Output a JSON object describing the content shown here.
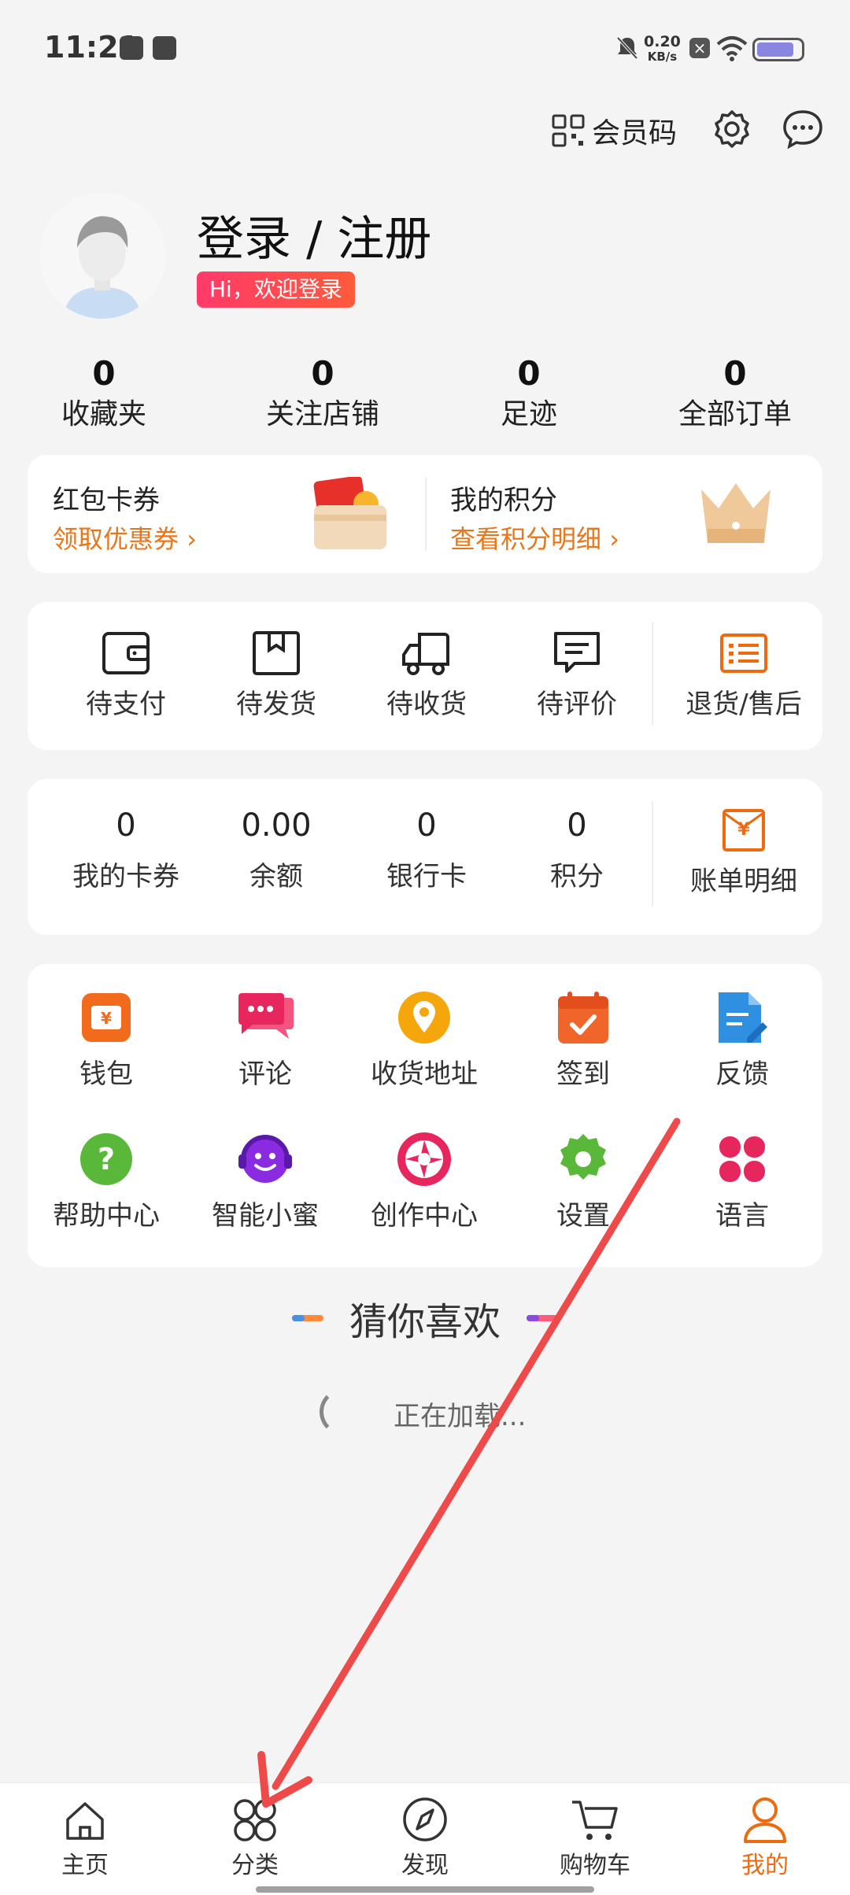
{
  "status_bar": {
    "time": "11:21",
    "net_speed_value": "0.20",
    "net_speed_unit": "KB/s",
    "battery_level": 0.85
  },
  "top_actions": {
    "member_code_label": "会员码"
  },
  "profile": {
    "login_label": "登录 / 注册",
    "welcome_text": "Hi，欢迎登录"
  },
  "stats": [
    {
      "value": "0",
      "label": "收藏夹"
    },
    {
      "value": "0",
      "label": "关注店铺"
    },
    {
      "value": "0",
      "label": "足迹"
    },
    {
      "value": "0",
      "label": "全部订单"
    }
  ],
  "coupon_card": {
    "left": {
      "title": "红包卡券",
      "link": "领取优惠券"
    },
    "right": {
      "title": "我的积分",
      "link": "查看积分明细"
    }
  },
  "orders": [
    {
      "label": "待支付",
      "icon": "wallet-icon"
    },
    {
      "label": "待发货",
      "icon": "box-icon"
    },
    {
      "label": "待收货",
      "icon": "truck-icon"
    },
    {
      "label": "待评价",
      "icon": "comment-icon"
    },
    {
      "label": "退货/售后",
      "icon": "return-list-icon"
    }
  ],
  "assets": [
    {
      "value": "0",
      "label": "我的卡券"
    },
    {
      "value": "0.00",
      "label": "余额"
    },
    {
      "value": "0",
      "label": "银行卡"
    },
    {
      "value": "0",
      "label": "积分"
    }
  ],
  "bill_label": "账单明细",
  "tools": [
    {
      "label": "钱包",
      "icon": "wallet-icon",
      "color": "#f26b1d"
    },
    {
      "label": "评论",
      "icon": "chat-icon",
      "color": "#e8265e"
    },
    {
      "label": "收货地址",
      "icon": "location-icon",
      "color": "#f5a60a"
    },
    {
      "label": "签到",
      "icon": "calendar-check-icon",
      "color": "#f0652a"
    },
    {
      "label": "反馈",
      "icon": "feedback-doc-icon",
      "color": "#2f8fe0"
    },
    {
      "label": "帮助中心",
      "icon": "help-icon",
      "color": "#59b83a"
    },
    {
      "label": "智能小蜜",
      "icon": "assistant-icon",
      "color": "#8a2be2"
    },
    {
      "label": "创作中心",
      "icon": "aperture-icon",
      "color": "#e8265e"
    },
    {
      "label": "设置",
      "icon": "gear-icon",
      "color": "#59b83a"
    },
    {
      "label": "语言",
      "icon": "clover-icon",
      "color": "#e8265e"
    }
  ],
  "guess": {
    "title": "猜你喜欢",
    "loading_text": "正在加载..."
  },
  "nav": [
    {
      "label": "主页",
      "icon": "home-icon",
      "active": false
    },
    {
      "label": "分类",
      "icon": "category-icon",
      "active": false
    },
    {
      "label": "发现",
      "icon": "compass-icon",
      "active": false
    },
    {
      "label": "购物车",
      "icon": "cart-icon",
      "active": false
    },
    {
      "label": "我的",
      "icon": "user-icon",
      "active": true
    }
  ],
  "colors": {
    "accent": "#ee6a10",
    "annotation_arrow": "#ef4a4a"
  }
}
